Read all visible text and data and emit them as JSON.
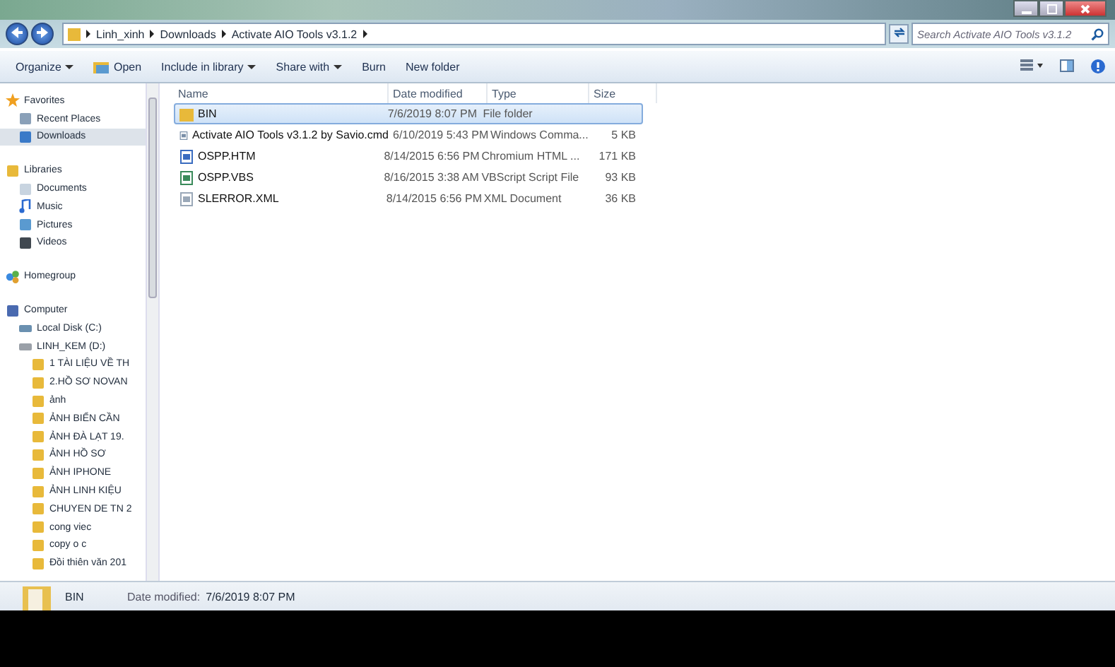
{
  "address_bar": {
    "path": [
      "Linh_xinh",
      "Downloads",
      "Activate AIO Tools v3.1.2"
    ]
  },
  "search": {
    "placeholder": "Search Activate AIO Tools v3.1.2"
  },
  "toolbar": {
    "items": [
      {
        "label": "Organize",
        "dropdown": true,
        "icon": false
      },
      {
        "label": "Open",
        "dropdown": false,
        "icon": true
      },
      {
        "label": "Include in library",
        "dropdown": true,
        "icon": false
      },
      {
        "label": "Share with",
        "dropdown": true,
        "icon": false
      },
      {
        "label": "Burn",
        "dropdown": false,
        "icon": false
      },
      {
        "label": "New folder",
        "dropdown": false,
        "icon": false
      }
    ]
  },
  "sidebar": {
    "items": [
      {
        "label": "Favorites",
        "kind": "star",
        "selected": false,
        "children": [
          {
            "label": "Recent Places",
            "kind": "recent",
            "selected": false
          },
          {
            "label": "Downloads",
            "kind": "downloads",
            "selected": true
          }
        ]
      },
      {
        "label": "Libraries",
        "kind": "library",
        "selected": false,
        "children": [
          {
            "label": "Documents",
            "kind": "document",
            "selected": false
          },
          {
            "label": "Music",
            "kind": "music",
            "selected": false
          },
          {
            "label": "Pictures",
            "kind": "picture",
            "selected": false
          },
          {
            "label": "Videos",
            "kind": "video",
            "selected": false
          }
        ]
      },
      {
        "label": "Homegroup",
        "kind": "homegroup",
        "selected": false
      },
      {
        "label": "Computer",
        "kind": "computer",
        "selected": false,
        "children": [
          {
            "label": "Local Disk (C:)",
            "kind": "disk",
            "selected": false
          },
          {
            "label": "LINH_KEM (D:)",
            "kind": "drive",
            "selected": false,
            "children": [
              {
                "label": "1 TÀI LIỆU VỀ TH",
                "kind": "folder",
                "selected": false
              },
              {
                "label": "2.HỒ SƠ NOVAN",
                "kind": "folder",
                "selected": false
              },
              {
                "label": "ảnh",
                "kind": "folder",
                "selected": false
              },
              {
                "label": "ẢNH BIỂN CẦN",
                "kind": "folder",
                "selected": false
              },
              {
                "label": "ẢNH ĐÀ LẠT 19.",
                "kind": "folder",
                "selected": false
              },
              {
                "label": "ẢNH HỒ SƠ",
                "kind": "folder",
                "selected": false
              },
              {
                "label": "ẢNH IPHONE",
                "kind": "folder",
                "selected": false
              },
              {
                "label": "ẢNH LINH KIỆU",
                "kind": "folder",
                "selected": false
              },
              {
                "label": "CHUYEN DE TN 2",
                "kind": "folder",
                "selected": false
              },
              {
                "label": "cong  viec",
                "kind": "folder",
                "selected": false
              },
              {
                "label": "copy o c",
                "kind": "folder",
                "selected": false
              },
              {
                "label": "Đồi thiên văn 201",
                "kind": "folder",
                "selected": false
              }
            ]
          }
        ]
      }
    ]
  },
  "table": {
    "columns": [
      "Name",
      "Date modified",
      "Type",
      "Size"
    ],
    "rows": [
      {
        "kind": "folder",
        "selected": true,
        "name": "BIN",
        "date": "7/6/2019 8:07 PM",
        "type": "File folder",
        "size": ""
      },
      {
        "kind": "cmd",
        "selected": false,
        "name": "Activate AIO Tools v3.1.2 by Savio.cmd",
        "date": "6/10/2019 5:43 PM",
        "type": "Windows Comma...",
        "size": "5 KB"
      },
      {
        "kind": "htm",
        "selected": false,
        "name": "OSPP.HTM",
        "date": "8/14/2015 6:56 PM",
        "type": "Chromium HTML ...",
        "size": "171 KB"
      },
      {
        "kind": "vbs",
        "selected": false,
        "name": "OSPP.VBS",
        "date": "8/16/2015 3:38 AM",
        "type": "VBScript Script File",
        "size": "93 KB"
      },
      {
        "kind": "xml",
        "selected": false,
        "name": "SLERROR.XML",
        "date": "8/14/2015 6:56 PM",
        "type": "XML Document",
        "size": "36 KB"
      }
    ]
  },
  "details_pane": {
    "name": "BIN",
    "label": "Date modified:",
    "value": "7/6/2019 8:07 PM"
  }
}
